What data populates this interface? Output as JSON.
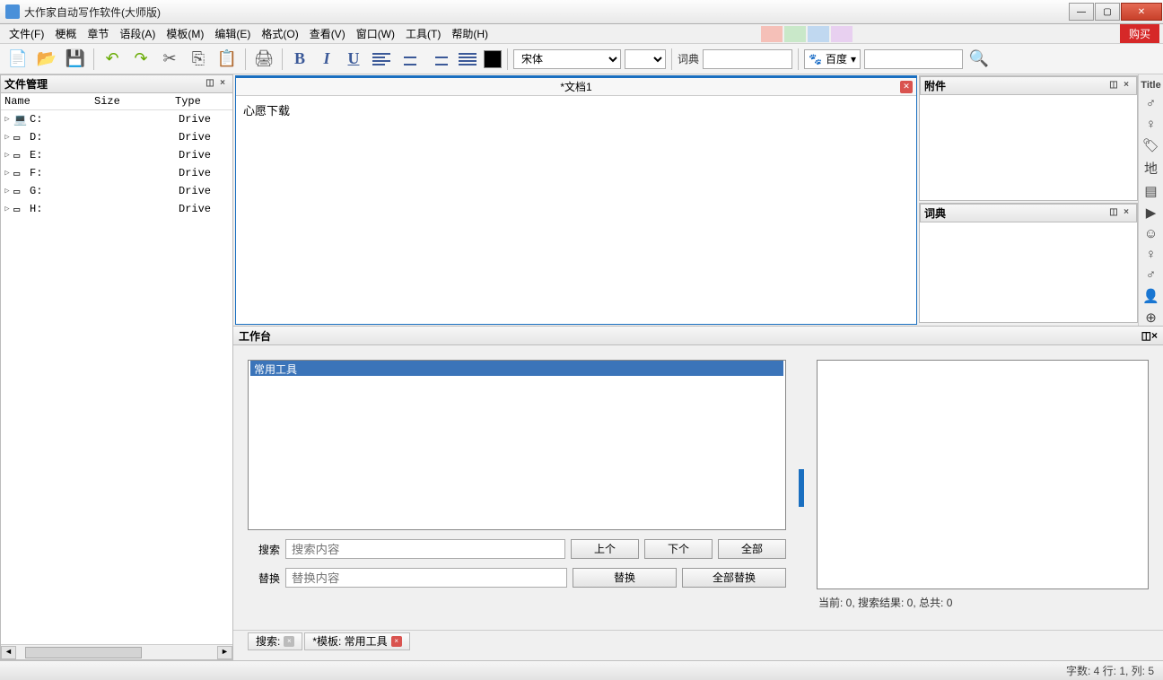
{
  "window": {
    "title": "大作家自动写作软件(大师版)"
  },
  "menu": {
    "items": [
      "文件(F)",
      "梗概",
      "章节",
      "语段(A)",
      "模板(M)",
      "编辑(E)",
      "格式(O)",
      "查看(V)",
      "窗口(W)",
      "工具(T)",
      "帮助(H)"
    ],
    "swatches": [
      "#f5c0b8",
      "#c9e8c9",
      "#c0d8f0",
      "#e8d0f0"
    ],
    "buy": "购买"
  },
  "toolbar": {
    "font_value": "宋体",
    "dict_label": "词典",
    "search_engine": "百度"
  },
  "file_panel": {
    "title": "文件管理",
    "columns": {
      "name": "Name",
      "size": "Size",
      "type": "Type"
    },
    "drives": [
      {
        "name": "C:",
        "type": "Drive",
        "special": true
      },
      {
        "name": "D:",
        "type": "Drive"
      },
      {
        "name": "E:",
        "type": "Drive"
      },
      {
        "name": "F:",
        "type": "Drive"
      },
      {
        "name": "G:",
        "type": "Drive"
      },
      {
        "name": "H:",
        "type": "Drive"
      }
    ]
  },
  "editor": {
    "tab_title": "*文档1",
    "content": "心愿下载"
  },
  "attachment": {
    "title": "附件"
  },
  "dictionary": {
    "title": "词典"
  },
  "sidebar_title": "Title",
  "workbench": {
    "title": "工作台",
    "tool_name": "常用工具",
    "status": "当前: 0, 搜索结果: 0, 总共: 0",
    "search_label": "搜索",
    "search_placeholder": "搜索内容",
    "replace_label": "替换",
    "replace_placeholder": "替换内容",
    "btn_prev": "上个",
    "btn_next": "下个",
    "btn_all": "全部",
    "btn_replace": "替换",
    "btn_replace_all": "全部替换"
  },
  "bottom_tabs": {
    "search": "搜索:",
    "template": "*模板: 常用工具"
  },
  "statusbar": {
    "text": "字数: 4 行: 1, 列: 5"
  }
}
